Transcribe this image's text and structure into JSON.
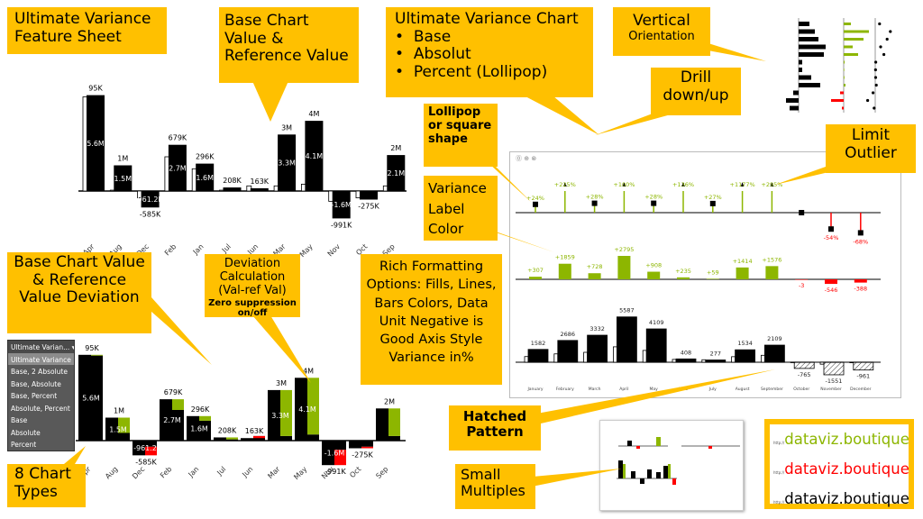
{
  "callouts": {
    "feature_sheet": "Ultimate Variance Feature Sheet",
    "base_ref": "Base Chart Value & Reference Value",
    "uv_chart_title": "Ultimate Variance Chart",
    "uv_chart_items": [
      "Base",
      "Absolut",
      "Percent (Lollipop)"
    ],
    "vertical": "Vertical",
    "orientation": "Orientation",
    "drill": "Drill down/up",
    "lollipop": "Lollipop or square shape",
    "label_color": "Variance Label Color",
    "limit_outlier": "Limit Outlier",
    "base_ref_dev": "Base Chart Value & Reference Value Deviation",
    "deviation_title": "Deviation Calculation (Val-ref Val)",
    "deviation_sub": "Zero suppression on/off",
    "rich": "Rich Formatting Options: Fills, Lines, Bars Colors, Data Unit Negative is Good Axis Style Variance in%",
    "hatched": "Hatched Pattern",
    "small_multiples": "Small Multiples",
    "chart_types": "8 Chart Types"
  },
  "dropdown": {
    "selected": "Ultimate Varian...",
    "options": [
      "Ultimate Variance",
      "Base, 2 Absolute",
      "Base, Absolute",
      "Base, Percent",
      "Absolute, Percent",
      "Base",
      "Absolute",
      "Percent"
    ]
  },
  "branding": {
    "text": "dataviz.boutique",
    "colors": [
      "#8DB600",
      "#FF0000",
      "#000000"
    ],
    "prefix": "http://"
  },
  "colors": {
    "accent": "#FFC000",
    "positive": "#8DB600",
    "negative": "#FF0000",
    "bar": "#000000"
  },
  "chart_data": [
    {
      "type": "bar",
      "categories": [
        "Apr",
        "Aug",
        "Dec",
        "Feb",
        "Jan",
        "Jul",
        "Jun",
        "Mar",
        "May",
        "Nov",
        "Oct",
        "Sep"
      ],
      "values": [
        5.6,
        1.5,
        -0.9612,
        2.7,
        1.6,
        0.208,
        0.163,
        3.3,
        4.1,
        -1.6,
        -0.5,
        2.1
      ],
      "reference": [
        5.5,
        0.05,
        -0.4,
        2.0,
        1.3,
        0.05,
        0.3,
        0.3,
        0.4,
        -0.6,
        -0.4,
        0.3
      ],
      "inner_labels": [
        "5.6M",
        "1.5M",
        "961.2K",
        "2.7M",
        "1.6M",
        "",
        "",
        "3.3M",
        "4.1M",
        "-1.6M",
        "",
        "2.1M"
      ],
      "outer_labels": [
        "95K",
        "1M",
        "-585K",
        "679K",
        "296K",
        "208K",
        "163K",
        "3M",
        "4M",
        "-991K",
        "-275K",
        "2M"
      ]
    },
    {
      "type": "bar",
      "categories": [
        "Apr",
        "Aug",
        "Dec",
        "Feb",
        "Jan",
        "Jul",
        "Jun",
        "Mar",
        "May",
        "Nov",
        "Oct",
        "Sep"
      ],
      "values": [
        5.6,
        1.5,
        -0.9612,
        2.7,
        1.6,
        0.208,
        0.163,
        3.3,
        4.1,
        -1.6,
        -0.5,
        2.1
      ],
      "reference": [
        5.55,
        0.5,
        -0.4,
        2.0,
        1.3,
        0.08,
        0.3,
        0.3,
        0.4,
        -0.6,
        -0.4,
        0.3
      ],
      "inner_labels": [
        "5.6M",
        "1.5M",
        "-961.2",
        "2.7M",
        "1.6M",
        "",
        "",
        "3.3M",
        "4.1M",
        "-1.6M",
        "",
        ""
      ],
      "outer_labels": [
        "95K",
        "1M",
        "-585K",
        "679K",
        "296K",
        "208K",
        "163K",
        "3M",
        "4M",
        "-991K",
        "-275K",
        "2M"
      ]
    },
    {
      "type": "bar",
      "categories": [
        "January",
        "February",
        "March",
        "April",
        "May",
        "June",
        "July",
        "August",
        "September",
        "October",
        "November",
        "December"
      ],
      "percent": [
        24,
        225,
        28,
        100,
        28,
        136,
        27,
        1177,
        295,
        null,
        -54,
        -68
      ],
      "percent_labels": [
        "+24%",
        "+225%",
        "+28%",
        "+100%",
        "+28%",
        "+136%",
        "+27%",
        "+1177%",
        "+295%",
        "",
        "-54%",
        "-68%"
      ],
      "outlier": [
        false,
        true,
        false,
        true,
        false,
        true,
        false,
        true,
        true,
        false,
        false,
        false
      ],
      "absolute": [
        307,
        1859,
        728,
        2795,
        908,
        235,
        59,
        1414,
        1576,
        -3,
        -546,
        -388
      ],
      "absolute_labels": [
        "+307",
        "+1859",
        "+728",
        "+2795",
        "+908",
        "+235",
        "+59",
        "+1414",
        "+1576",
        "-3",
        "-546",
        "-388"
      ],
      "base": [
        1582,
        2686,
        3332,
        5587,
        4109,
        408,
        277,
        1534,
        2109,
        -765,
        -1551,
        -961
      ],
      "base_labels": [
        "1582",
        "2686",
        "3332",
        "5587",
        "4109",
        "408",
        "277",
        "1534",
        "2109",
        "-765",
        "-1551",
        "-961"
      ]
    }
  ]
}
